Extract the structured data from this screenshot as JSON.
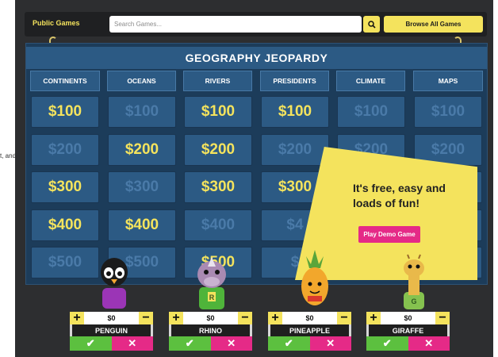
{
  "toolbar": {
    "public_games": "Public Games",
    "search_placeholder": "Search Games...",
    "browse_label": "Browse All Games"
  },
  "board": {
    "title": "GEOGRAPHY JEOPARDY",
    "categories": [
      "CONTINENTS",
      "OCEANS",
      "RIVERS",
      "PRESIDENTS",
      "CLIMATE",
      "MAPS"
    ],
    "rows": [
      [
        "$100",
        "$100",
        "$100",
        "$100",
        "$100",
        "$100"
      ],
      [
        "$200",
        "$200",
        "$200",
        "$200",
        "$200",
        "$200"
      ],
      [
        "$300",
        "$300",
        "$300",
        "$300",
        "",
        ""
      ],
      [
        "$400",
        "$400",
        "$400",
        "$4",
        "",
        ""
      ],
      [
        "$500",
        "$500",
        "$500",
        "$",
        "",
        ""
      ]
    ],
    "active": [
      [
        true,
        false,
        true,
        true,
        false,
        false
      ],
      [
        false,
        true,
        true,
        false,
        false,
        false
      ],
      [
        true,
        false,
        true,
        true,
        false,
        false
      ],
      [
        true,
        true,
        false,
        false,
        false,
        false
      ],
      [
        false,
        false,
        true,
        false,
        false,
        false
      ]
    ]
  },
  "promo": {
    "text": "It's free, easy and loads of fun!",
    "button": "Play Demo Game"
  },
  "left_cut_text": "t, and",
  "players": [
    {
      "name": "PENGUIN",
      "score": "$0"
    },
    {
      "name": "RHINO",
      "score": "$0"
    },
    {
      "name": "PINEAPPLE",
      "score": "$0"
    },
    {
      "name": "GIRAFFE",
      "score": "$0"
    }
  ],
  "colors": {
    "accent": "#f4e35d",
    "pink": "#e52a87",
    "green": "#5cc03f",
    "board": "#2c5a84"
  }
}
